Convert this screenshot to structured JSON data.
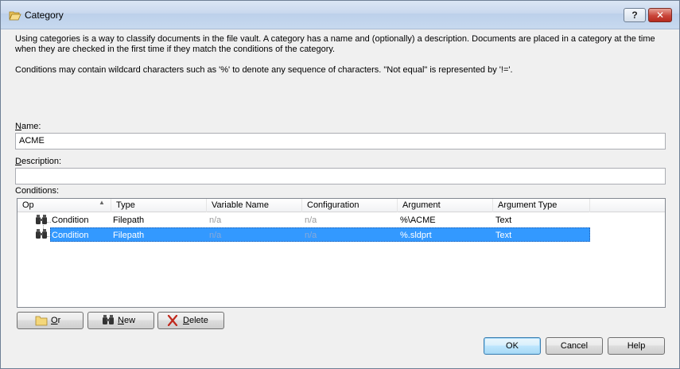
{
  "window": {
    "title": "Category",
    "help_label": "?",
    "close_label": "✕"
  },
  "intro": {
    "paragraph1": "Using categories is a way to classify documents in the file vault. A category has a name and (optionally) a description. Documents are placed in a category at the time when they are checked in the first time if they match the conditions of the category.",
    "paragraph2": "Conditions may contain wildcard characters such as '%' to denote any sequence of characters. \"Not equal\" is represented by '!='."
  },
  "name": {
    "label_u": "N",
    "label_rest": "ame:",
    "value": "ACME"
  },
  "description": {
    "label_u": "D",
    "label_rest": "escription:",
    "value": ""
  },
  "conditions": {
    "label": "Conditions:",
    "columns": [
      "Op",
      "Type",
      "Variable Name",
      "Configuration",
      "Argument",
      "Argument Type"
    ],
    "rows": [
      {
        "op": "Condition",
        "type": "Filepath",
        "variable": "n/a",
        "configuration": "n/a",
        "argument": "%\\ACME",
        "argument_type": "Text"
      },
      {
        "op": "Condition",
        "type": "Filepath",
        "variable": "n/a",
        "configuration": "n/a",
        "argument": "%.sldprt",
        "argument_type": "Text"
      }
    ],
    "selected_row": 1
  },
  "buttons": {
    "or": {
      "u": "O",
      "rest": "r"
    },
    "new": {
      "u": "N",
      "rest": "ew"
    },
    "delete": {
      "u": "D",
      "rest": "elete"
    },
    "ok": "OK",
    "cancel": "Cancel",
    "help": "Help"
  },
  "icons": {
    "title": "folder-open-icon",
    "row": "binoculars-icon",
    "or": "folder-icon",
    "new": "binoculars-icon",
    "delete": "red-x-icon"
  }
}
